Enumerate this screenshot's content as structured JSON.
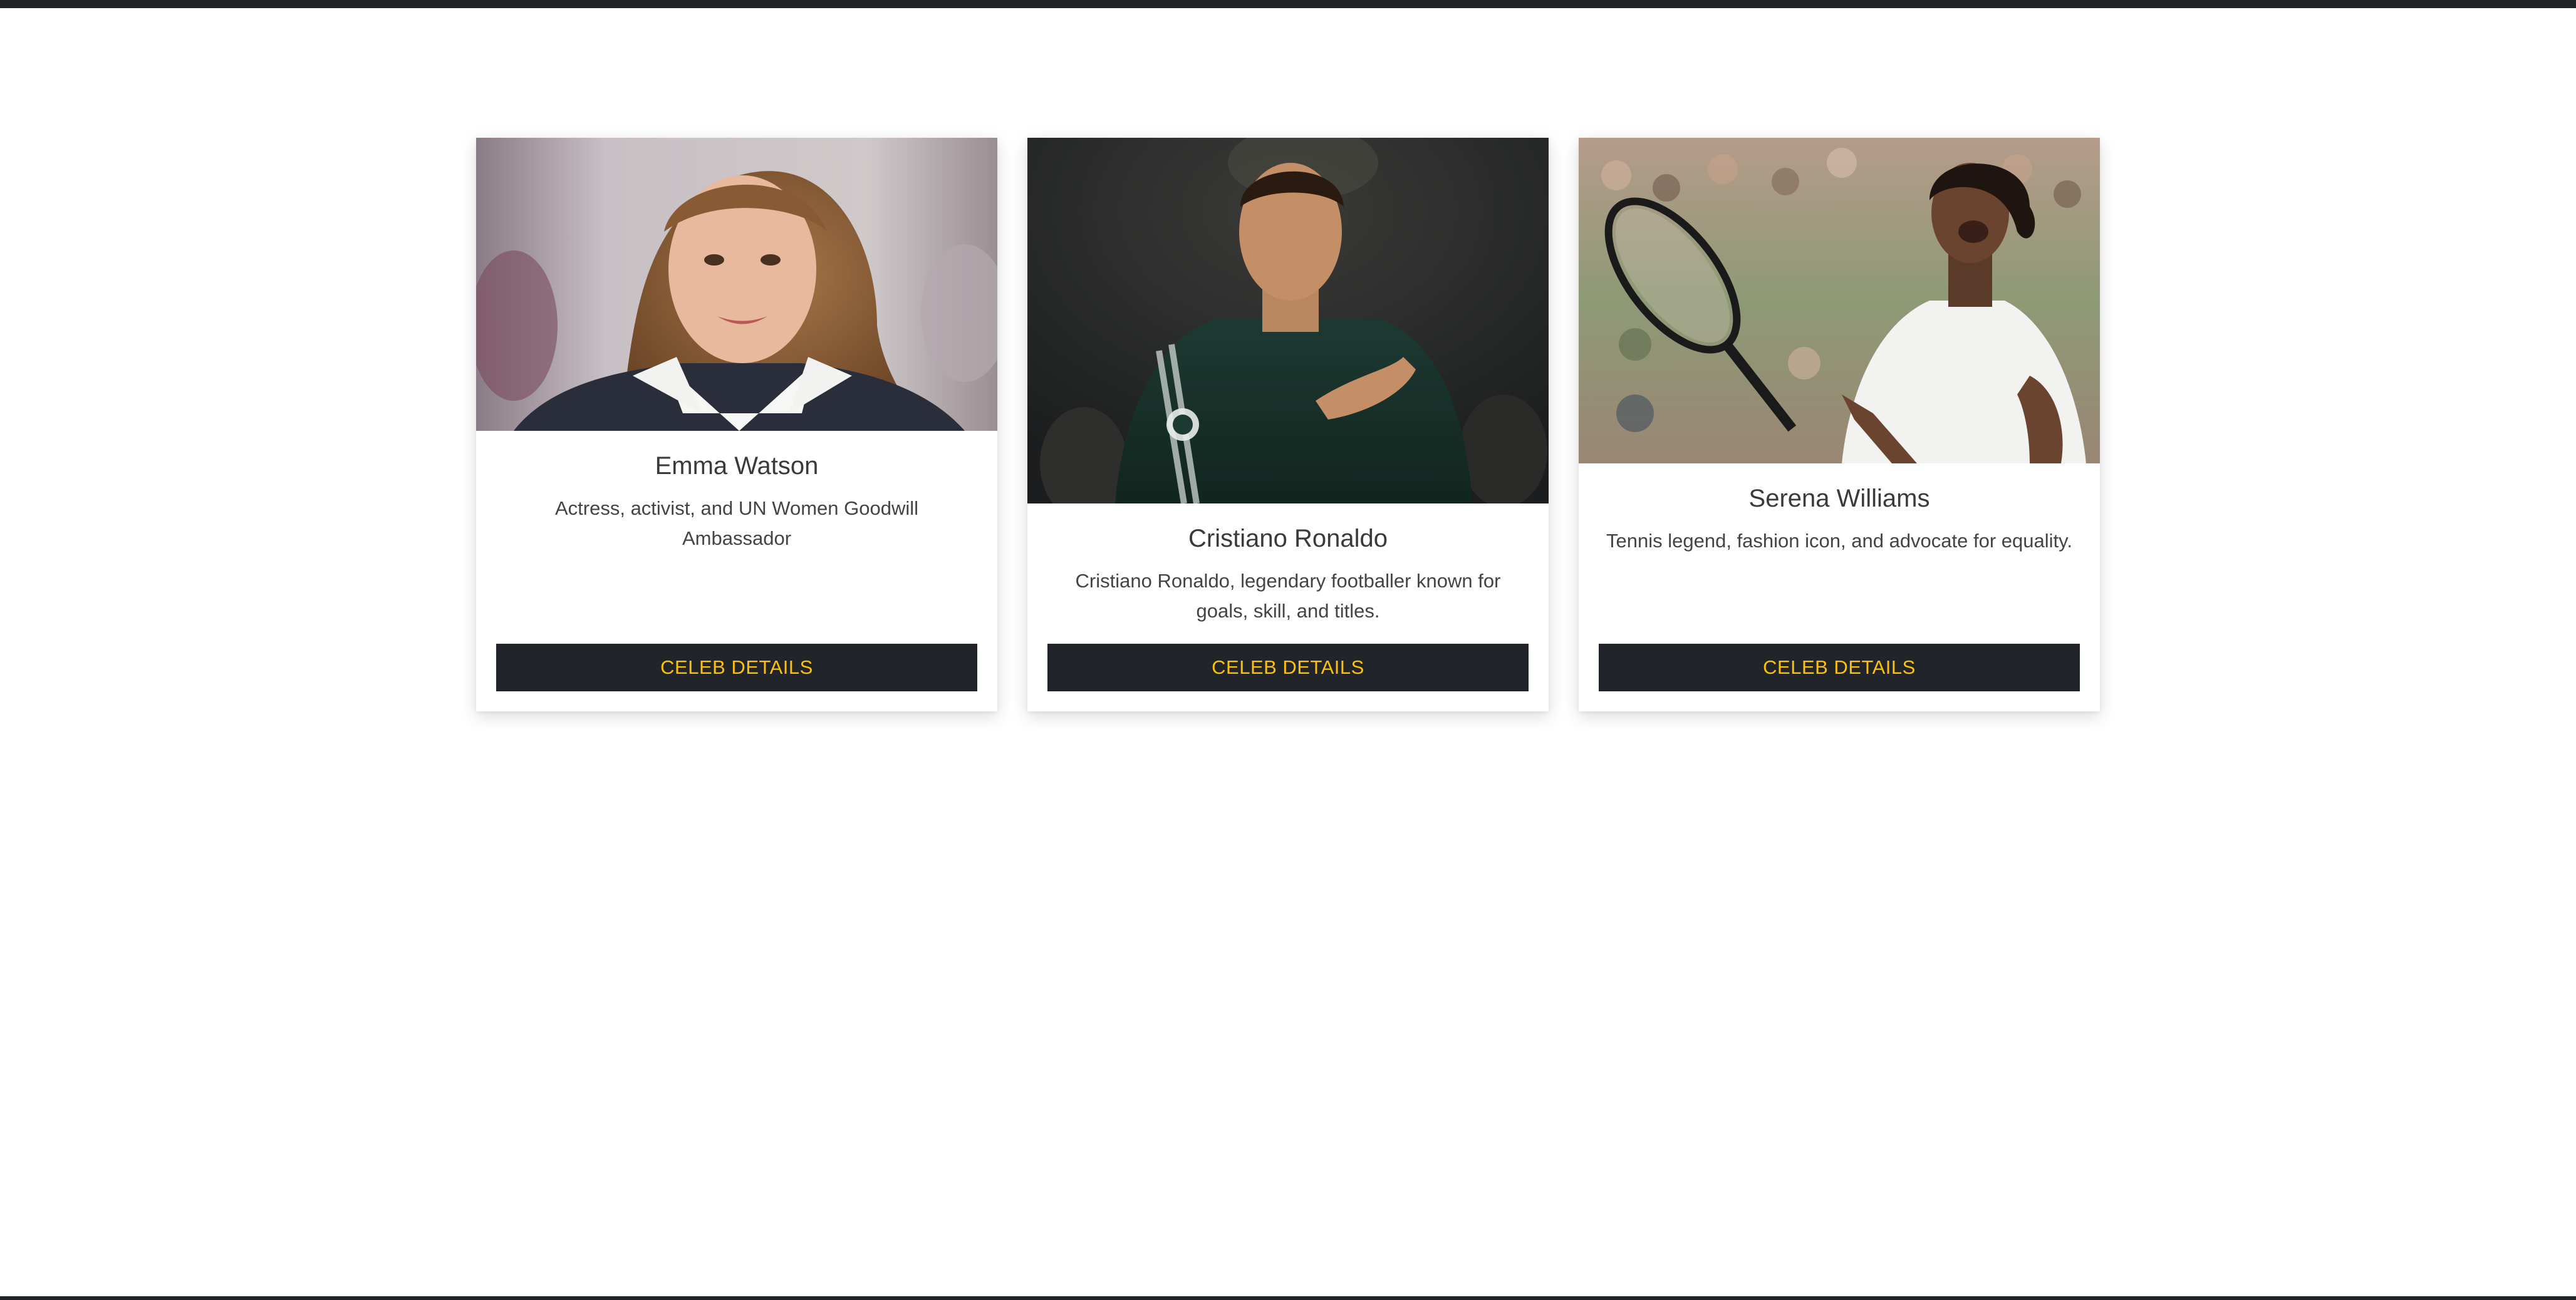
{
  "cards": [
    {
      "name": "Emma Watson",
      "description": "Actress, activist, and UN Women Goodwill Ambassador",
      "button_label": "CELEB DETAILS"
    },
    {
      "name": "Cristiano Ronaldo",
      "description": "Cristiano Ronaldo, legendary footballer known for goals, skill, and titles.",
      "button_label": "CELEB DETAILS"
    },
    {
      "name": "Serena Williams",
      "description": "Tennis legend, fashion icon, and advocate for equality.",
      "button_label": "CELEB DETAILS"
    }
  ],
  "colors": {
    "button_bg": "#212529",
    "button_text": "#ffc107",
    "page_bg": "#ffffff"
  }
}
